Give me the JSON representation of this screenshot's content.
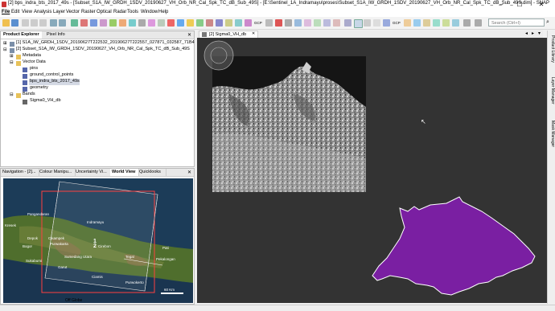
{
  "window": {
    "title": "[2] bps_indra_bts_2017_49s - [Subset_S1A_IW_GRDH_1SDV_20190627_VH_Orb_NR_Cal_Spk_TC_dB_Sub_49S] - [E:\\Sentinel_1A_Indramayu\\proses\\Subset_S1A_IW_GRDH_1SDV_20190627_VH_Orb_NR_Cal_Spk_TC_dB_Sub_49S.dim] - SNAP",
    "minimize": "–",
    "maximize": "☐",
    "close": "✕"
  },
  "menu": [
    "File",
    "Edit",
    "View",
    "Analysis",
    "Layer",
    "Vector",
    "Raster",
    "Optical",
    "Radar",
    "Tools",
    "Window",
    "Help"
  ],
  "search": {
    "placeholder": "Search (Ctrl+I)"
  },
  "toolbar_labels": {
    "gcp": "GCP",
    "gcp2": "GCP"
  },
  "left_panel": {
    "tabs": [
      "Product Explorer",
      "Pixel Info"
    ],
    "close": "✕",
    "tree": [
      {
        "label": "[1] S1A_IW_GRDH_1SDV_20190627T222532_20190627T222557_027871_032587_71B4",
        "level": 0
      },
      {
        "label": "[2] Subset_S1A_IW_GRDH_1SDV_20190627_VH_Orb_NR_Cal_Spk_TC_dB_Sub_49S",
        "level": 0
      },
      {
        "label": "Metadata",
        "level": 1
      },
      {
        "label": "Vector Data",
        "level": 1
      },
      {
        "label": "pins",
        "level": 2
      },
      {
        "label": "ground_control_points",
        "level": 2
      },
      {
        "label": "bps_indra_bts_2017_49s",
        "level": 2
      },
      {
        "label": "geometry",
        "level": 2
      },
      {
        "label": "Bands",
        "level": 1
      },
      {
        "label": "Sigma0_VH_db",
        "level": 2
      }
    ]
  },
  "nav_panel": {
    "tabs": [
      "Navigation - [2]...",
      "Colour Manipu...",
      "Uncertainty Vi...",
      "World View",
      "Quicklooks"
    ],
    "close": "✕",
    "cities": [
      {
        "name": "Indramayu"
      },
      {
        "name": "Pangandaran"
      },
      {
        "name": "Kresek"
      },
      {
        "name": "Cikampek"
      },
      {
        "name": "Purwakarta"
      },
      {
        "name": "Depok"
      },
      {
        "name": "Bogor"
      },
      {
        "name": "Sukabumi"
      },
      {
        "name": "Sumedang Utara"
      },
      {
        "name": "Cirebon"
      },
      {
        "name": "Garut"
      },
      {
        "name": "Tegal"
      },
      {
        "name": "Pekalongan"
      },
      {
        "name": "Purwokerto"
      },
      {
        "name": "Pati"
      },
      {
        "name": "Ciamis"
      }
    ],
    "marker": "1\n2",
    "scale": "60 Km",
    "footer": "Off Globe"
  },
  "view": {
    "tab": "[2] Sigma0_VH_db",
    "tab_close": "✕",
    "background_color": "#333333",
    "polygon_color": "#7a1fa2"
  },
  "right_bar": [
    "Product Library",
    "Layer Manager",
    "Mask Manager"
  ]
}
